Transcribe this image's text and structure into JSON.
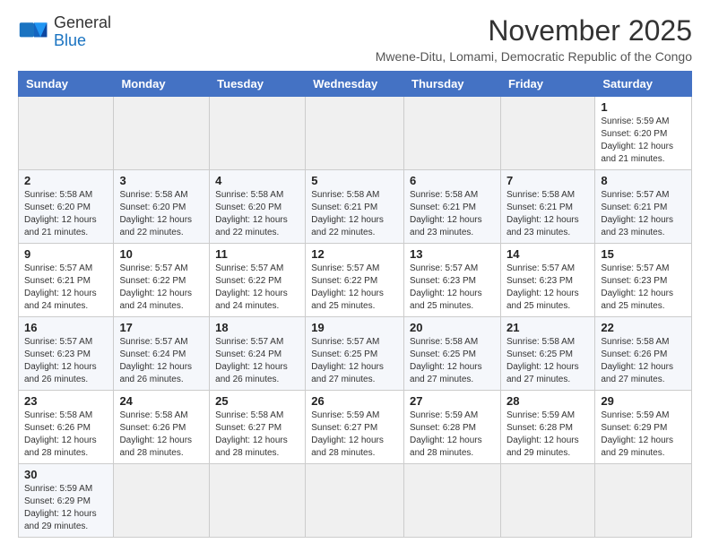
{
  "logo": {
    "line1": "General",
    "line2": "Blue"
  },
  "header": {
    "title": "November 2025",
    "subtitle": "Mwene-Ditu, Lomami, Democratic Republic of the Congo"
  },
  "weekdays": [
    "Sunday",
    "Monday",
    "Tuesday",
    "Wednesday",
    "Thursday",
    "Friday",
    "Saturday"
  ],
  "weeks": [
    [
      {
        "day": "",
        "info": ""
      },
      {
        "day": "",
        "info": ""
      },
      {
        "day": "",
        "info": ""
      },
      {
        "day": "",
        "info": ""
      },
      {
        "day": "",
        "info": ""
      },
      {
        "day": "",
        "info": ""
      },
      {
        "day": "1",
        "info": "Sunrise: 5:59 AM\nSunset: 6:20 PM\nDaylight: 12 hours and 21 minutes."
      }
    ],
    [
      {
        "day": "2",
        "info": "Sunrise: 5:58 AM\nSunset: 6:20 PM\nDaylight: 12 hours and 21 minutes."
      },
      {
        "day": "3",
        "info": "Sunrise: 5:58 AM\nSunset: 6:20 PM\nDaylight: 12 hours and 22 minutes."
      },
      {
        "day": "4",
        "info": "Sunrise: 5:58 AM\nSunset: 6:20 PM\nDaylight: 12 hours and 22 minutes."
      },
      {
        "day": "5",
        "info": "Sunrise: 5:58 AM\nSunset: 6:21 PM\nDaylight: 12 hours and 22 minutes."
      },
      {
        "day": "6",
        "info": "Sunrise: 5:58 AM\nSunset: 6:21 PM\nDaylight: 12 hours and 23 minutes."
      },
      {
        "day": "7",
        "info": "Sunrise: 5:58 AM\nSunset: 6:21 PM\nDaylight: 12 hours and 23 minutes."
      },
      {
        "day": "8",
        "info": "Sunrise: 5:57 AM\nSunset: 6:21 PM\nDaylight: 12 hours and 23 minutes."
      }
    ],
    [
      {
        "day": "9",
        "info": "Sunrise: 5:57 AM\nSunset: 6:21 PM\nDaylight: 12 hours and 24 minutes."
      },
      {
        "day": "10",
        "info": "Sunrise: 5:57 AM\nSunset: 6:22 PM\nDaylight: 12 hours and 24 minutes."
      },
      {
        "day": "11",
        "info": "Sunrise: 5:57 AM\nSunset: 6:22 PM\nDaylight: 12 hours and 24 minutes."
      },
      {
        "day": "12",
        "info": "Sunrise: 5:57 AM\nSunset: 6:22 PM\nDaylight: 12 hours and 25 minutes."
      },
      {
        "day": "13",
        "info": "Sunrise: 5:57 AM\nSunset: 6:23 PM\nDaylight: 12 hours and 25 minutes."
      },
      {
        "day": "14",
        "info": "Sunrise: 5:57 AM\nSunset: 6:23 PM\nDaylight: 12 hours and 25 minutes."
      },
      {
        "day": "15",
        "info": "Sunrise: 5:57 AM\nSunset: 6:23 PM\nDaylight: 12 hours and 25 minutes."
      }
    ],
    [
      {
        "day": "16",
        "info": "Sunrise: 5:57 AM\nSunset: 6:23 PM\nDaylight: 12 hours and 26 minutes."
      },
      {
        "day": "17",
        "info": "Sunrise: 5:57 AM\nSunset: 6:24 PM\nDaylight: 12 hours and 26 minutes."
      },
      {
        "day": "18",
        "info": "Sunrise: 5:57 AM\nSunset: 6:24 PM\nDaylight: 12 hours and 26 minutes."
      },
      {
        "day": "19",
        "info": "Sunrise: 5:57 AM\nSunset: 6:25 PM\nDaylight: 12 hours and 27 minutes."
      },
      {
        "day": "20",
        "info": "Sunrise: 5:58 AM\nSunset: 6:25 PM\nDaylight: 12 hours and 27 minutes."
      },
      {
        "day": "21",
        "info": "Sunrise: 5:58 AM\nSunset: 6:25 PM\nDaylight: 12 hours and 27 minutes."
      },
      {
        "day": "22",
        "info": "Sunrise: 5:58 AM\nSunset: 6:26 PM\nDaylight: 12 hours and 27 minutes."
      }
    ],
    [
      {
        "day": "23",
        "info": "Sunrise: 5:58 AM\nSunset: 6:26 PM\nDaylight: 12 hours and 28 minutes."
      },
      {
        "day": "24",
        "info": "Sunrise: 5:58 AM\nSunset: 6:26 PM\nDaylight: 12 hours and 28 minutes."
      },
      {
        "day": "25",
        "info": "Sunrise: 5:58 AM\nSunset: 6:27 PM\nDaylight: 12 hours and 28 minutes."
      },
      {
        "day": "26",
        "info": "Sunrise: 5:59 AM\nSunset: 6:27 PM\nDaylight: 12 hours and 28 minutes."
      },
      {
        "day": "27",
        "info": "Sunrise: 5:59 AM\nSunset: 6:28 PM\nDaylight: 12 hours and 28 minutes."
      },
      {
        "day": "28",
        "info": "Sunrise: 5:59 AM\nSunset: 6:28 PM\nDaylight: 12 hours and 29 minutes."
      },
      {
        "day": "29",
        "info": "Sunrise: 5:59 AM\nSunset: 6:29 PM\nDaylight: 12 hours and 29 minutes."
      }
    ],
    [
      {
        "day": "30",
        "info": "Sunrise: 5:59 AM\nSunset: 6:29 PM\nDaylight: 12 hours and 29 minutes."
      },
      {
        "day": "",
        "info": ""
      },
      {
        "day": "",
        "info": ""
      },
      {
        "day": "",
        "info": ""
      },
      {
        "day": "",
        "info": ""
      },
      {
        "day": "",
        "info": ""
      },
      {
        "day": "",
        "info": ""
      }
    ]
  ]
}
